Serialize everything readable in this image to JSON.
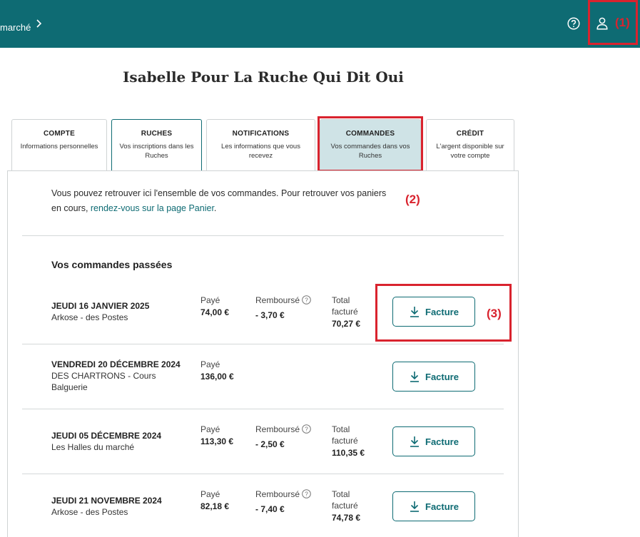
{
  "header": {
    "breadcrumb": "marché"
  },
  "annotations": {
    "a1": "(1)",
    "a2": "(2)",
    "a3": "(3)"
  },
  "title": "Isabelle Pour La Ruche Qui Dit Oui",
  "tabs": [
    {
      "title": "COMPTE",
      "sub": "Informations personnelles"
    },
    {
      "title": "RUCHES",
      "sub": "Vos inscriptions dans les Ruches"
    },
    {
      "title": "NOTIFICATIONS",
      "sub": "Les informations que vous recevez"
    },
    {
      "title": "COMMANDES",
      "sub": "Vos commandes dans vos Ruches"
    },
    {
      "title": "CRÉDIT",
      "sub": "L'argent disponible sur votre compte"
    }
  ],
  "intro": {
    "text": "Vous pouvez retrouver ici l'ensemble de vos commandes. Pour retrouver vos paniers en cours, ",
    "link": "rendez-vous sur la page Panier",
    "end": "."
  },
  "section_title": "Vos commandes passées",
  "labels": {
    "paid": "Payé",
    "refunded": "Remboursé",
    "total": "Total facturé",
    "invoice": "Facture"
  },
  "orders": [
    {
      "date": "JEUDI 16 JANVIER 2025",
      "place": "Arkose - des Postes",
      "paid": "74,00 €",
      "refunded": "- 3,70 €",
      "total": "70,27 €"
    },
    {
      "date": "VENDREDI 20 DÉCEMBRE 2024",
      "place": "DES CHARTRONS - Cours Balguerie",
      "paid": "136,00 €"
    },
    {
      "date": "JEUDI 05 DÉCEMBRE 2024",
      "place": "Les Halles du marché",
      "paid": "113,30 €",
      "refunded": "- 2,50 €",
      "total": "110,35 €"
    },
    {
      "date": "JEUDI 21 NOVEMBRE 2024",
      "place": "Arkose - des Postes",
      "paid": "82,18 €",
      "refunded": "- 7,40 €",
      "total": "74,78 €"
    }
  ],
  "colors": {
    "brand": "#0e6b73",
    "annotation": "#d9232e",
    "selected_tab": "#cfe3e6"
  }
}
